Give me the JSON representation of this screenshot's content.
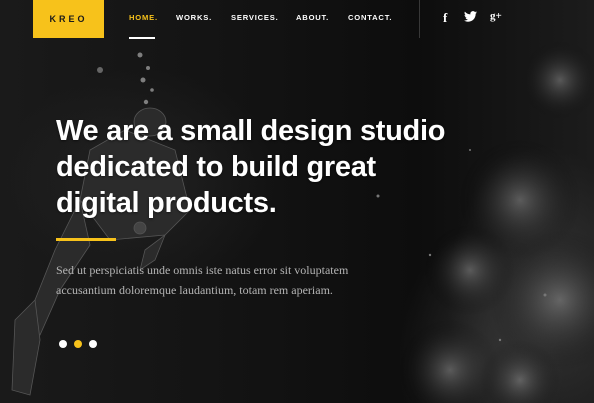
{
  "brand": {
    "logo": "KREO",
    "accent": "#f7c21b"
  },
  "nav": {
    "items": [
      {
        "label": "HOME.",
        "active": true
      },
      {
        "label": "WORKS.",
        "active": false
      },
      {
        "label": "SERVICES.",
        "active": false
      },
      {
        "label": "ABOUT.",
        "active": false
      },
      {
        "label": "CONTACT.",
        "active": false
      }
    ]
  },
  "social": {
    "facebook": "f",
    "twitter": "twitter-bird-icon",
    "google_plus": "g+"
  },
  "hero": {
    "headline_line1": "We are a small design studio",
    "headline_line2": "dedicated to build great",
    "headline_line3": "digital products.",
    "subtext_line1": "Sed ut perspiciatis unde omnis iste natus error sit voluptatem",
    "subtext_line2": "accusantium doloremque laudantium, totam rem aperiam."
  },
  "slider": {
    "dot_count": 3,
    "active_index": 1
  }
}
